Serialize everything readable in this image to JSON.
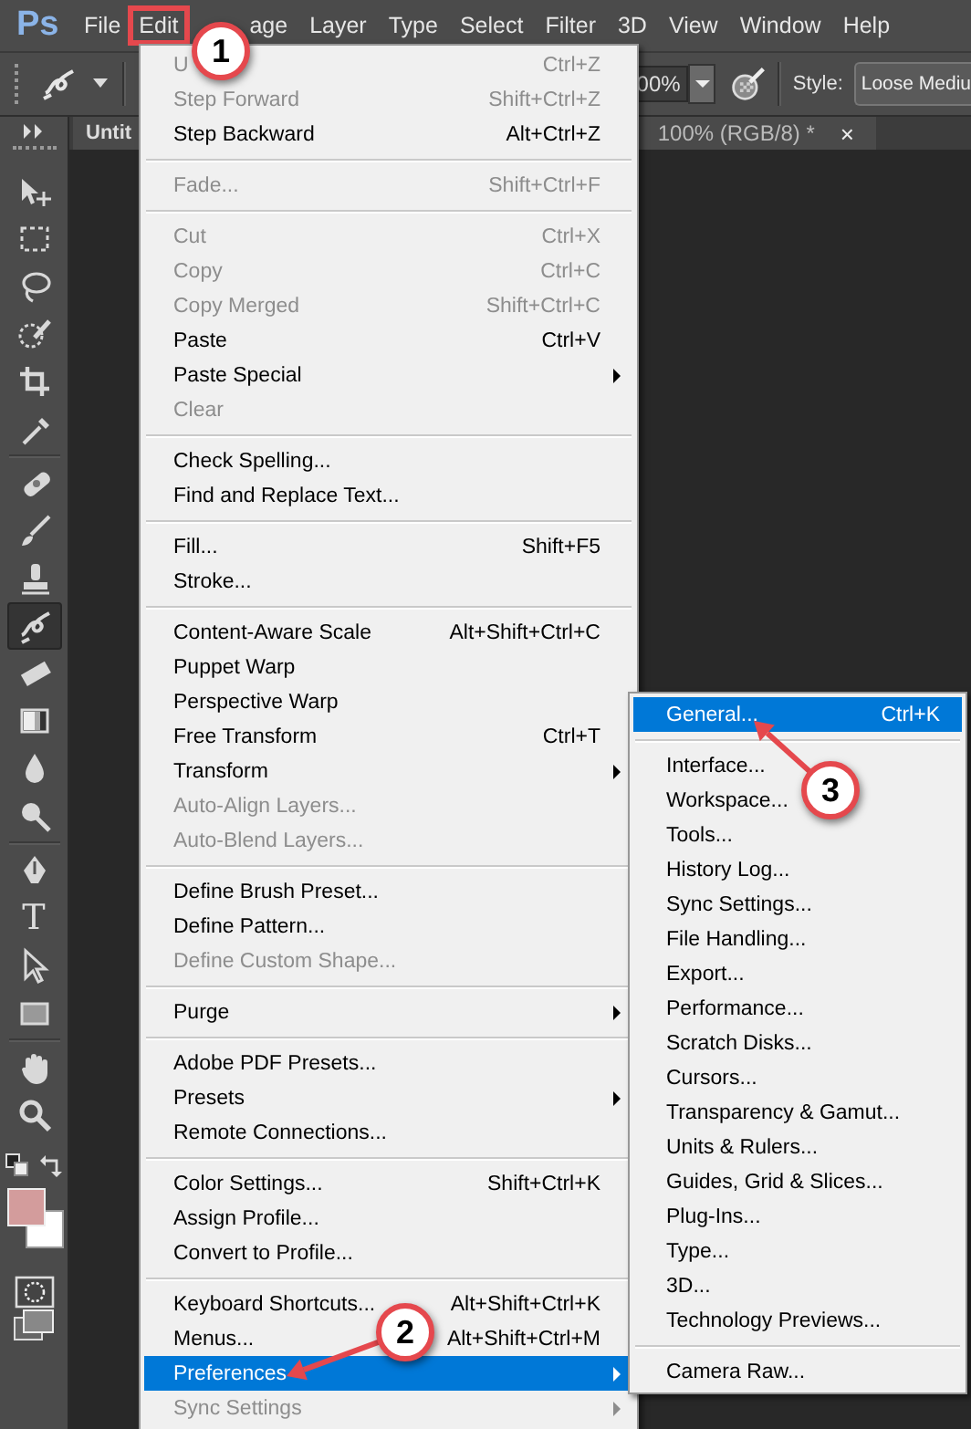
{
  "menu_bar": {
    "logo": "Ps",
    "items": [
      {
        "label": "File",
        "boxed": false
      },
      {
        "label": "Edit",
        "boxed": true
      },
      {
        "label": "age",
        "boxed": false
      },
      {
        "label": "Layer",
        "boxed": false
      },
      {
        "label": "Type",
        "boxed": false
      },
      {
        "label": "Select",
        "boxed": false
      },
      {
        "label": "Filter",
        "boxed": false
      },
      {
        "label": "3D",
        "boxed": false
      },
      {
        "label": "View",
        "boxed": false
      },
      {
        "label": "Window",
        "boxed": false
      },
      {
        "label": "Help",
        "boxed": false
      }
    ]
  },
  "options_bar": {
    "opacity_value": "00%",
    "style_label": "Style:",
    "style_value": "Loose Mediu"
  },
  "document_tab": {
    "title_start": "Untit",
    "title_end": "100% (RGB/8) *",
    "close": "×"
  },
  "toolbox": {
    "tools": [
      {
        "kind": "move",
        "selected": false
      },
      {
        "kind": "marquee",
        "selected": false
      },
      {
        "kind": "lasso",
        "selected": false
      },
      {
        "kind": "quick_select",
        "selected": false
      },
      {
        "kind": "crop",
        "selected": false
      },
      {
        "kind": "eyedropper",
        "selected": false
      },
      {
        "kind": "separator"
      },
      {
        "kind": "healing",
        "selected": false
      },
      {
        "kind": "brush",
        "selected": false
      },
      {
        "kind": "stamp",
        "selected": false
      },
      {
        "kind": "history_brush",
        "selected": true
      },
      {
        "kind": "eraser",
        "selected": false
      },
      {
        "kind": "gradient",
        "selected": false
      },
      {
        "kind": "blur",
        "selected": false
      },
      {
        "kind": "dodge",
        "selected": false
      },
      {
        "kind": "separator"
      },
      {
        "kind": "pen",
        "selected": false
      },
      {
        "kind": "type",
        "label": "T",
        "selected": false
      },
      {
        "kind": "path_select",
        "selected": false
      },
      {
        "kind": "shape",
        "selected": false
      },
      {
        "kind": "separator"
      },
      {
        "kind": "hand",
        "selected": false
      },
      {
        "kind": "zoom",
        "selected": false
      }
    ]
  },
  "edit_menu": {
    "items": [
      {
        "kind": "item",
        "label": "U",
        "shortcut": "Ctrl+Z",
        "disabled": true,
        "has_submenu": false,
        "selected": false
      },
      {
        "kind": "item",
        "label": "Step Forward",
        "shortcut": "Shift+Ctrl+Z",
        "disabled": true,
        "has_submenu": false,
        "selected": false
      },
      {
        "kind": "item",
        "label": "Step Backward",
        "shortcut": "Alt+Ctrl+Z",
        "disabled": false,
        "has_submenu": false,
        "selected": false
      },
      {
        "kind": "separator"
      },
      {
        "kind": "item",
        "label": "Fade...",
        "shortcut": "Shift+Ctrl+F",
        "disabled": true,
        "has_submenu": false,
        "selected": false
      },
      {
        "kind": "separator"
      },
      {
        "kind": "item",
        "label": "Cut",
        "shortcut": "Ctrl+X",
        "disabled": true,
        "has_submenu": false,
        "selected": false
      },
      {
        "kind": "item",
        "label": "Copy",
        "shortcut": "Ctrl+C",
        "disabled": true,
        "has_submenu": false,
        "selected": false
      },
      {
        "kind": "item",
        "label": "Copy Merged",
        "shortcut": "Shift+Ctrl+C",
        "disabled": true,
        "has_submenu": false,
        "selected": false
      },
      {
        "kind": "item",
        "label": "Paste",
        "shortcut": "Ctrl+V",
        "disabled": false,
        "has_submenu": false,
        "selected": false
      },
      {
        "kind": "item",
        "label": "Paste Special",
        "disabled": false,
        "has_submenu": true,
        "selected": false
      },
      {
        "kind": "item",
        "label": "Clear",
        "disabled": true,
        "has_submenu": false,
        "selected": false
      },
      {
        "kind": "separator"
      },
      {
        "kind": "item",
        "label": "Check Spelling...",
        "disabled": false,
        "has_submenu": false,
        "selected": false
      },
      {
        "kind": "item",
        "label": "Find and Replace Text...",
        "disabled": false,
        "has_submenu": false,
        "selected": false
      },
      {
        "kind": "separator"
      },
      {
        "kind": "item",
        "label": "Fill...",
        "shortcut": "Shift+F5",
        "disabled": false,
        "has_submenu": false,
        "selected": false
      },
      {
        "kind": "item",
        "label": "Stroke...",
        "disabled": false,
        "has_submenu": false,
        "selected": false
      },
      {
        "kind": "separator"
      },
      {
        "kind": "item",
        "label": "Content-Aware Scale",
        "shortcut": "Alt+Shift+Ctrl+C",
        "disabled": false,
        "has_submenu": false,
        "selected": false
      },
      {
        "kind": "item",
        "label": "Puppet Warp",
        "disabled": false,
        "has_submenu": false,
        "selected": false
      },
      {
        "kind": "item",
        "label": "Perspective Warp",
        "disabled": false,
        "has_submenu": false,
        "selected": false
      },
      {
        "kind": "item",
        "label": "Free Transform",
        "shortcut": "Ctrl+T",
        "disabled": false,
        "has_submenu": false,
        "selected": false
      },
      {
        "kind": "item",
        "label": "Transform",
        "disabled": false,
        "has_submenu": true,
        "selected": false
      },
      {
        "kind": "item",
        "label": "Auto-Align Layers...",
        "disabled": true,
        "has_submenu": false,
        "selected": false
      },
      {
        "kind": "item",
        "label": "Auto-Blend Layers...",
        "disabled": true,
        "has_submenu": false,
        "selected": false
      },
      {
        "kind": "separator"
      },
      {
        "kind": "item",
        "label": "Define Brush Preset...",
        "disabled": false,
        "has_submenu": false,
        "selected": false
      },
      {
        "kind": "item",
        "label": "Define Pattern...",
        "disabled": false,
        "has_submenu": false,
        "selected": false
      },
      {
        "kind": "item",
        "label": "Define Custom Shape...",
        "disabled": true,
        "has_submenu": false,
        "selected": false
      },
      {
        "kind": "separator"
      },
      {
        "kind": "item",
        "label": "Purge",
        "disabled": false,
        "has_submenu": true,
        "selected": false
      },
      {
        "kind": "separator"
      },
      {
        "kind": "item",
        "label": "Adobe PDF Presets...",
        "disabled": false,
        "has_submenu": false,
        "selected": false
      },
      {
        "kind": "item",
        "label": "Presets",
        "disabled": false,
        "has_submenu": true,
        "selected": false
      },
      {
        "kind": "item",
        "label": "Remote Connections...",
        "disabled": false,
        "has_submenu": false,
        "selected": false
      },
      {
        "kind": "separator"
      },
      {
        "kind": "item",
        "label": "Color Settings...",
        "shortcut": "Shift+Ctrl+K",
        "disabled": false,
        "has_submenu": false,
        "selected": false
      },
      {
        "kind": "item",
        "label": "Assign Profile...",
        "disabled": false,
        "has_submenu": false,
        "selected": false
      },
      {
        "kind": "item",
        "label": "Convert to Profile...",
        "disabled": false,
        "has_submenu": false,
        "selected": false
      },
      {
        "kind": "separator"
      },
      {
        "kind": "item",
        "label": "Keyboard Shortcuts...",
        "shortcut": "Alt+Shift+Ctrl+K",
        "disabled": false,
        "has_submenu": false,
        "selected": false
      },
      {
        "kind": "item",
        "label": "Menus...",
        "shortcut": "Alt+Shift+Ctrl+M",
        "disabled": false,
        "has_submenu": false,
        "selected": false
      },
      {
        "kind": "item",
        "label": "Preferences",
        "disabled": false,
        "has_submenu": true,
        "selected": true
      },
      {
        "kind": "item",
        "label": "Sync Settings",
        "disabled": true,
        "has_submenu": true,
        "selected": false
      }
    ]
  },
  "preferences_submenu": {
    "items": [
      {
        "kind": "item",
        "label": "General...",
        "shortcut": "Ctrl+K",
        "selected": true
      },
      {
        "kind": "separator"
      },
      {
        "kind": "item",
        "label": "Interface...",
        "selected": false
      },
      {
        "kind": "item",
        "label": "Workspace...",
        "selected": false
      },
      {
        "kind": "item",
        "label": "Tools...",
        "selected": false
      },
      {
        "kind": "item",
        "label": "History Log...",
        "selected": false
      },
      {
        "kind": "item",
        "label": "Sync Settings...",
        "selected": false
      },
      {
        "kind": "item",
        "label": "File Handling...",
        "selected": false
      },
      {
        "kind": "item",
        "label": "Export...",
        "selected": false
      },
      {
        "kind": "item",
        "label": "Performance...",
        "selected": false
      },
      {
        "kind": "item",
        "label": "Scratch Disks...",
        "selected": false
      },
      {
        "kind": "item",
        "label": "Cursors...",
        "selected": false
      },
      {
        "kind": "item",
        "label": "Transparency & Gamut...",
        "selected": false
      },
      {
        "kind": "item",
        "label": "Units & Rulers...",
        "selected": false
      },
      {
        "kind": "item",
        "label": "Guides, Grid & Slices...",
        "selected": false
      },
      {
        "kind": "item",
        "label": "Plug-Ins...",
        "selected": false
      },
      {
        "kind": "item",
        "label": "Type...",
        "selected": false
      },
      {
        "kind": "item",
        "label": "3D...",
        "selected": false
      },
      {
        "kind": "item",
        "label": "Technology Previews...",
        "selected": false
      },
      {
        "kind": "separator"
      },
      {
        "kind": "item",
        "label": "Camera Raw...",
        "selected": false
      }
    ]
  },
  "callouts": [
    {
      "number": "1",
      "arrow": false
    },
    {
      "number": "2",
      "arrow": true
    },
    {
      "number": "3",
      "arrow": true
    }
  ]
}
